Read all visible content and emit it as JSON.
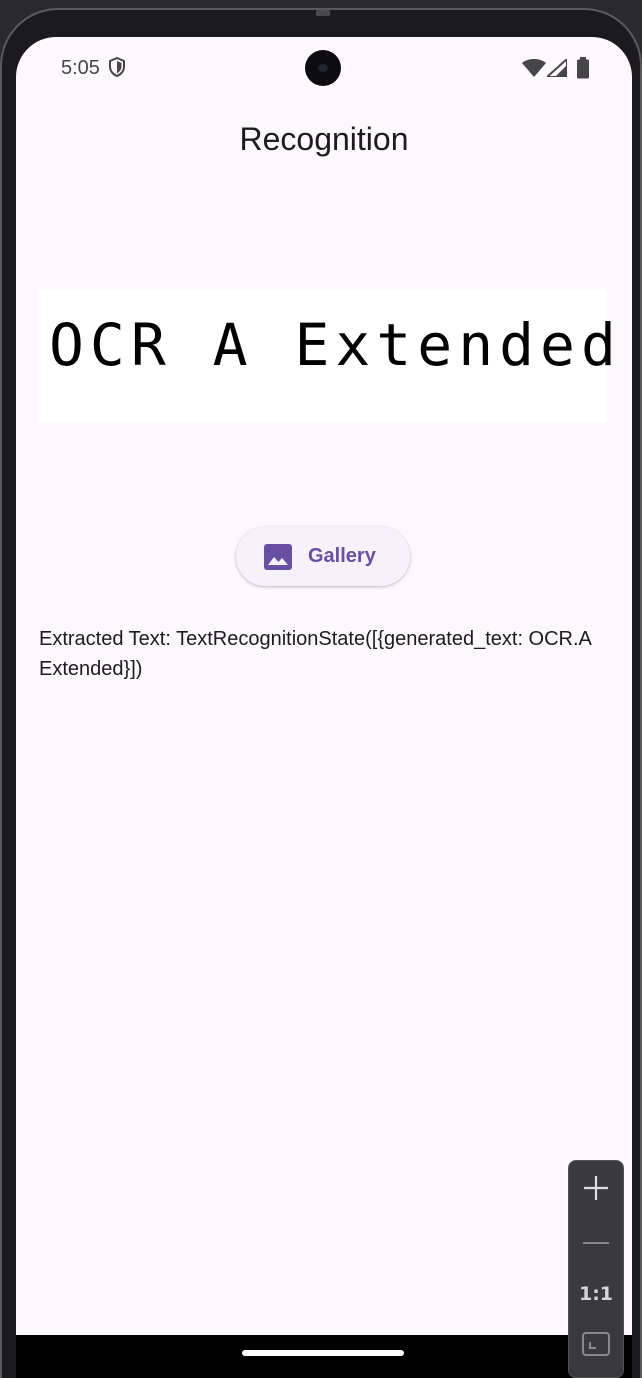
{
  "status_bar": {
    "time": "5:05",
    "icons": [
      "shield-icon",
      "wifi-icon",
      "signal-icon",
      "battery-icon"
    ]
  },
  "app": {
    "title": "Recognition"
  },
  "image_preview": {
    "text": "OCR A Extended"
  },
  "gallery_button": {
    "label": "Gallery",
    "icon": "image-icon"
  },
  "result": {
    "extracted_text": "Extracted Text: TextRecognitionState([{generated_text: OCR.A Extended}])"
  },
  "zoom_controls": {
    "one_to_one_label": "1:1",
    "icons": [
      "plus-icon",
      "minus-icon",
      "fit-screen-icon"
    ]
  },
  "colors": {
    "background": "#fdf7fe",
    "accent": "#6750a4",
    "button_bg": "#f7f2fa"
  }
}
